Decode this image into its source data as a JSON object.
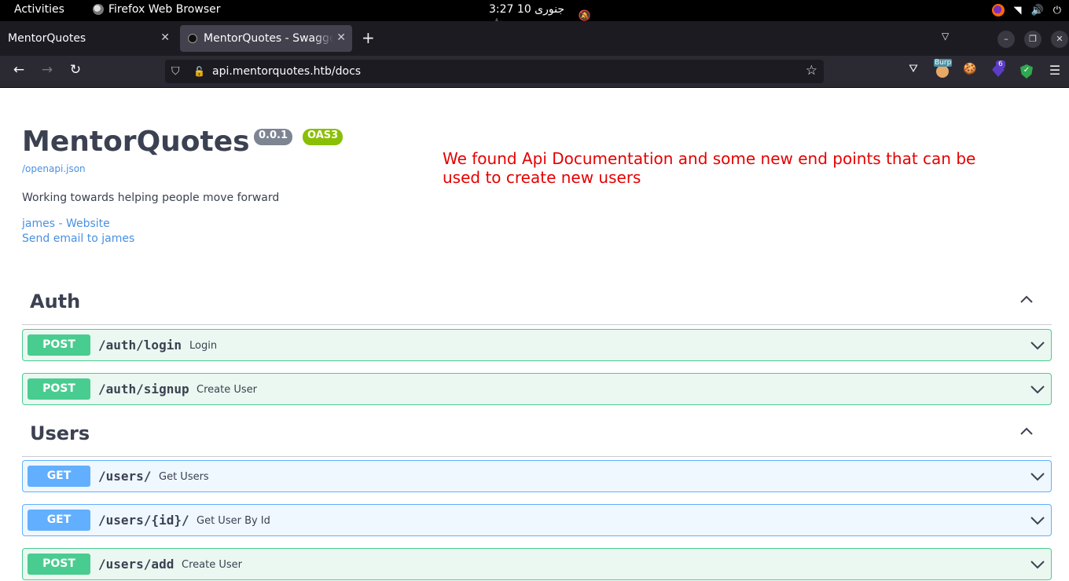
{
  "topbar": {
    "activities": "Activities",
    "app_name": "Firefox Web Browser",
    "clock": "جنوری 10  3:27 ش"
  },
  "tabs": [
    {
      "label": "MentorQuotes",
      "active": false
    },
    {
      "label": "MentorQuotes - Swagger UI",
      "active": true
    }
  ],
  "navbar": {
    "url": "api.mentorquotes.htb/docs"
  },
  "extensions": {
    "burp_label": "Burp",
    "foxyproxy_count": "6"
  },
  "page": {
    "title": "MentorQuotes",
    "version_badge": "0.0.1",
    "oas_badge": "OAS3",
    "openapi_link": "/openapi.json",
    "description": "Working towards helping people move forward",
    "contact_website": "james - Website",
    "contact_email": "Send email to james",
    "annotation": "We found Api Documentation and some new end points that can be used to create new users"
  },
  "sections": [
    {
      "name": "Auth",
      "operations": [
        {
          "method": "POST",
          "path": "/auth/login",
          "summary": "Login"
        },
        {
          "method": "POST",
          "path": "/auth/signup",
          "summary": "Create User"
        }
      ]
    },
    {
      "name": "Users",
      "operations": [
        {
          "method": "GET",
          "path": "/users/",
          "summary": "Get Users"
        },
        {
          "method": "GET",
          "path": "/users/{id}/",
          "summary": "Get User By Id"
        },
        {
          "method": "POST",
          "path": "/users/add",
          "summary": "Create User"
        }
      ]
    }
  ],
  "colors": {
    "post": "#49cc90",
    "get": "#61affe",
    "annotation": "#e60000",
    "link": "#4990e2"
  }
}
